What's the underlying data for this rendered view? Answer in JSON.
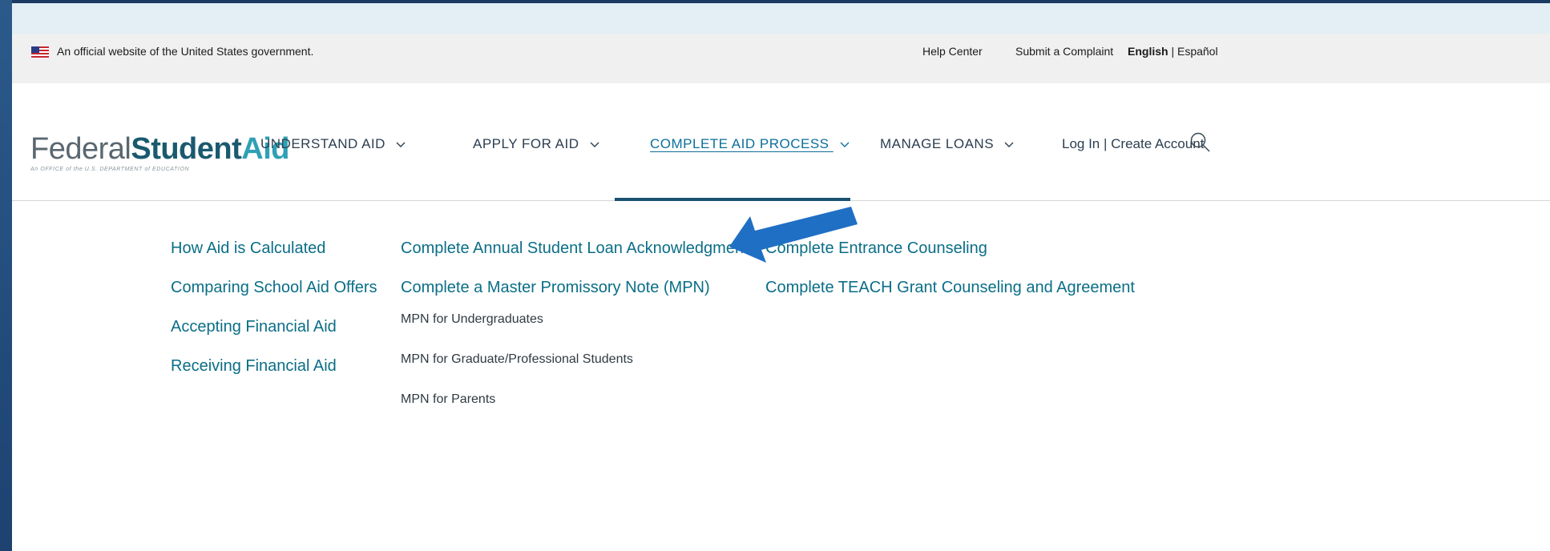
{
  "gov_banner": {
    "official_text": "An official website of the United States government.",
    "help_center": "Help Center",
    "submit_complaint": "Submit a Complaint",
    "lang_english": "English",
    "lang_sep": " | ",
    "lang_espanol": "Español"
  },
  "logo": {
    "federal": "Federal",
    "student": "Student",
    "aid": "Aid",
    "tagline": "An OFFICE of the U.S. DEPARTMENT of EDUCATION"
  },
  "nav": {
    "items": [
      {
        "label": "UNDERSTAND AID"
      },
      {
        "label": "APPLY FOR AID"
      },
      {
        "label": "COMPLETE AID PROCESS"
      },
      {
        "label": "MANAGE LOANS"
      }
    ],
    "log_in": "Log In",
    "separator": " | ",
    "create_account": "Create Account"
  },
  "dropdown": {
    "col1": [
      "How Aid is Calculated",
      "Comparing School Aid Offers",
      "Accepting Financial Aid",
      "Receiving Financial Aid"
    ],
    "col2_main": [
      "Complete Annual Student Loan Acknowledgment",
      "Complete a Master Promissory Note (MPN)"
    ],
    "col2_sub": [
      "MPN for Undergraduates",
      "MPN for Graduate/Professional Students",
      "MPN for Parents"
    ],
    "col3": [
      "Complete Entrance Counseling",
      "Complete TEACH Grant Counseling and Agreement"
    ]
  },
  "colors": {
    "link": "#0a6e87",
    "active_bar": "#1a5170",
    "annotation_arrow": "#1f6fc4"
  }
}
